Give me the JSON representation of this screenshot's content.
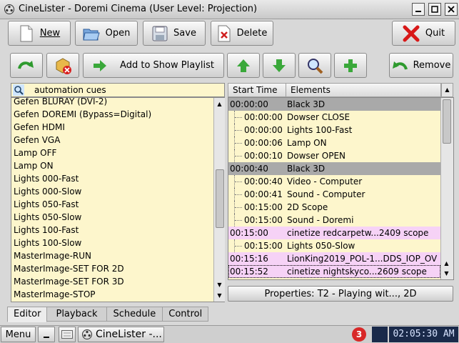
{
  "window": {
    "title": "CineLister - Doremi Cinema (User Level: Projection)"
  },
  "toolbar1": {
    "new": "New",
    "open": "Open",
    "save": "Save",
    "delete": "Delete",
    "quit": "Quit"
  },
  "toolbar2": {
    "add_to_playlist": "Add to Show Playlist",
    "remove": "Remove"
  },
  "search": {
    "value": "automation cues"
  },
  "cues": [
    "Gefen BLURAY (DVI-2)",
    "Gefen DOREMI (Bypass=Digital)",
    "Gefen HDMI",
    "Gefen VGA",
    "Lamp OFF",
    "Lamp ON",
    "Lights 000-Fast",
    "Lights 000-Slow",
    "Lights 050-Fast",
    "Lights 050-Slow",
    "Lights 100-Fast",
    "Lights 100-Slow",
    "MasterImage-RUN",
    "MasterImage-SET FOR 2D",
    "MasterImage-SET FOR 3D",
    "MasterImage-STOP"
  ],
  "playlist": {
    "columns": [
      "Start Time",
      "Elements"
    ],
    "rows": [
      {
        "time": "00:00:00",
        "element": "Black 3D",
        "kind": "grey"
      },
      {
        "time": "00:00:00",
        "element": "Dowser CLOSE",
        "kind": "sub"
      },
      {
        "time": "00:00:00",
        "element": "Lights 100-Fast",
        "kind": "sub"
      },
      {
        "time": "00:00:06",
        "element": "Lamp ON",
        "kind": "sub"
      },
      {
        "time": "00:00:10",
        "element": "Dowser OPEN",
        "kind": "sub"
      },
      {
        "time": "00:00:40",
        "element": "Black 3D",
        "kind": "grey"
      },
      {
        "time": "00:00:40",
        "element": "Video - Computer",
        "kind": "sub"
      },
      {
        "time": "00:00:41",
        "element": "Sound - Computer",
        "kind": "sub"
      },
      {
        "time": "00:15:00",
        "element": "2D Scope",
        "kind": "sub"
      },
      {
        "time": "00:15:00",
        "element": "Sound - Doremi",
        "kind": "sub"
      },
      {
        "time": "00:15:00",
        "element": "cinetize redcarpetw...2409 scope",
        "kind": "pink"
      },
      {
        "time": "00:15:00",
        "element": "Lights 050-Slow",
        "kind": "sub"
      },
      {
        "time": "00:15:16",
        "element": "LionKing2019_POL-1...DDS_IOP_OV",
        "kind": "pink"
      },
      {
        "time": "00:15:52",
        "element": "cinetize nightskyco...2609 scope",
        "kind": "pink"
      }
    ]
  },
  "properties": "Properties: T2 - Playing wit..., 2D",
  "tabs": [
    "Editor",
    "Playback",
    "Schedule",
    "Control"
  ],
  "taskbar": {
    "menu": "Menu",
    "task": "CineLister -...",
    "badge": "3",
    "clock": "02:05:30 AM"
  },
  "colors": {
    "list_bg": "#fdf6cc",
    "group_row": "#a9a9a9",
    "feature_row": "#f6d2f6",
    "clock_bg": "#1a2a4a"
  }
}
